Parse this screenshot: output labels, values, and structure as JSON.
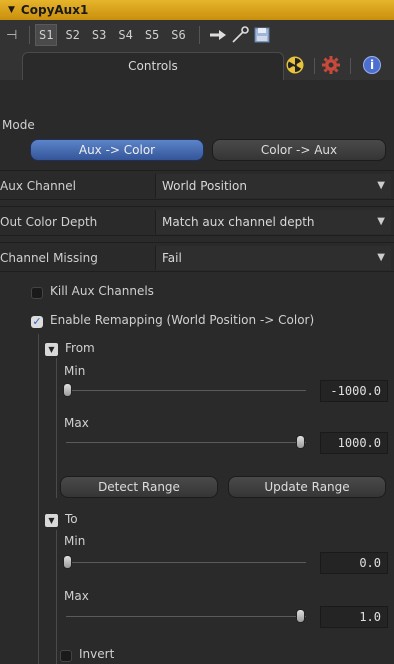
{
  "header": {
    "title": "CopyAux1"
  },
  "toolbar": {
    "slots": [
      "S1",
      "S2",
      "S3",
      "S4",
      "S5",
      "S6"
    ],
    "active_slot": "S1"
  },
  "tabs": {
    "controls_label": "Controls"
  },
  "mode": {
    "label": "Mode",
    "options": [
      "Aux -> Color",
      "Color -> Aux"
    ],
    "selected": "Aux -> Color"
  },
  "aux_channel": {
    "label": "Aux Channel",
    "value": "World Position"
  },
  "out_color_depth": {
    "label": "Out Color Depth",
    "value": "Match aux channel depth"
  },
  "channel_missing": {
    "label": "Channel Missing",
    "value": "Fail"
  },
  "kill_aux": {
    "label": "Kill Aux Channels",
    "checked": false
  },
  "enable_remapping": {
    "label": "Enable Remapping (World Position -> Color)",
    "checked": true
  },
  "from": {
    "label": "From",
    "min": {
      "label": "Min",
      "value": "-1000.0"
    },
    "max": {
      "label": "Max",
      "value": "1000.0"
    }
  },
  "buttons": {
    "detect_range": "Detect Range",
    "update_range": "Update Range"
  },
  "to": {
    "label": "To",
    "min": {
      "label": "Min",
      "value": "0.0"
    },
    "max": {
      "label": "Max",
      "value": "1.0"
    }
  },
  "invert": {
    "label": "Invert",
    "checked": false
  },
  "colors": {
    "title_bar": "#d9a31a",
    "selected_button": "#4a6fb5",
    "panel": "#2a2a2a"
  }
}
